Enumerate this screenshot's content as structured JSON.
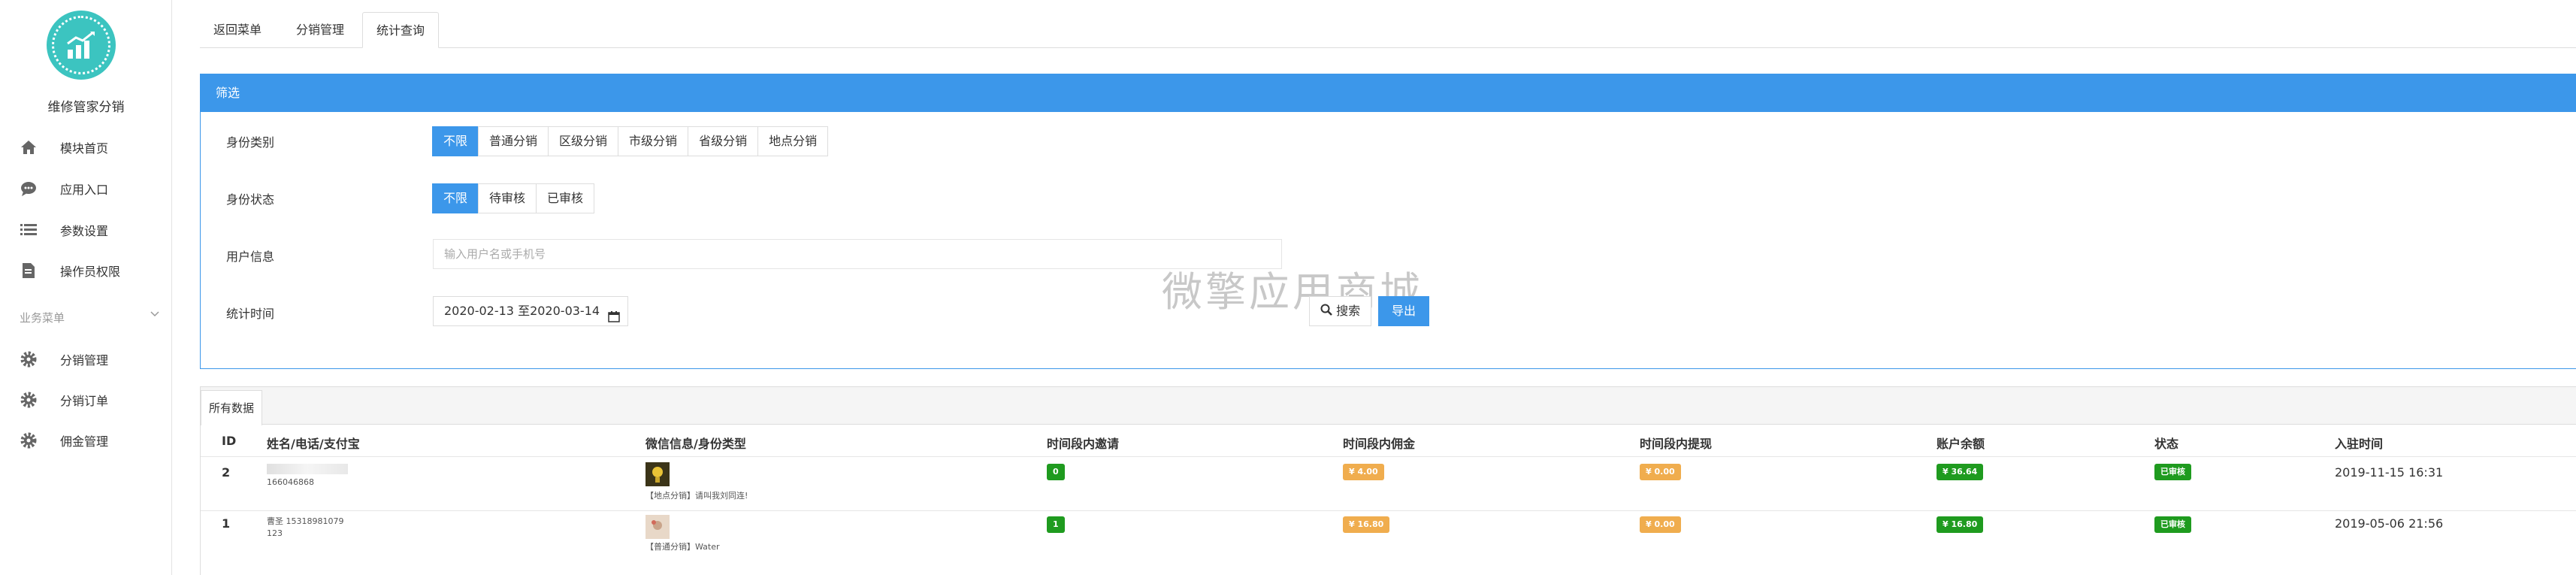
{
  "sidebar": {
    "app_name": "维修管家分销",
    "items": [
      {
        "label": "模块首页",
        "icon": "home-icon"
      },
      {
        "label": "应用入口",
        "icon": "chat-bubble-icon"
      },
      {
        "label": "参数设置",
        "icon": "list-settings-icon"
      },
      {
        "label": "操作员权限",
        "icon": "document-permission-icon"
      }
    ],
    "group_label": "业务菜单",
    "group_items": [
      {
        "label": "分销管理",
        "icon": "gear-icon"
      },
      {
        "label": "分销订单",
        "icon": "gear-icon"
      },
      {
        "label": "佣金管理",
        "icon": "gear-icon"
      }
    ]
  },
  "tabs": [
    "返回菜单",
    "分销管理",
    "统计查询"
  ],
  "filter": {
    "title": "筛选",
    "identity_type_label": "身份类别",
    "identity_types": [
      "不限",
      "普通分销",
      "区级分销",
      "市级分销",
      "省级分销",
      "地点分销"
    ],
    "status_label": "身份状态",
    "statuses": [
      "不限",
      "待审核",
      "已审核"
    ],
    "user_info_label": "用户信息",
    "user_info_placeholder": "输入用户名或手机号",
    "time_label": "统计时间",
    "date_range": "2020-02-13 至2020-03-14",
    "search_label": "搜索",
    "export_label": "导出"
  },
  "watermark": "微擎应用商城",
  "data": {
    "tab_label": "所有数据",
    "headers": [
      "ID",
      "姓名/电话/支付宝",
      "微信信息/身份类型",
      "时间段内邀请",
      "时间段内佣金",
      "时间段内提现",
      "账户余额",
      "状态",
      "入驻时间"
    ],
    "rows": [
      {
        "id": "2",
        "name_line1": "",
        "name_line2": "166046868",
        "wechat_info": "【地点分销】请叫我刘同连!",
        "invites": "0",
        "commission": "¥ 4.00",
        "withdrawn": "¥ 0.00",
        "balance": "¥ 36.64",
        "status": "已审核",
        "joined": "2019-11-15 16:31"
      },
      {
        "id": "1",
        "name_line1": "曹圣 15318981079",
        "name_line2": "123",
        "wechat_info": "【普通分销】Water",
        "invites": "1",
        "commission": "¥ 16.80",
        "withdrawn": "¥ 0.00",
        "balance": "¥ 16.80",
        "status": "已审核",
        "joined": "2019-05-06 21:56"
      }
    ]
  },
  "colors": {
    "primary": "#3c97ea",
    "logo": "#3cc4c0",
    "badge_green": "#1f9b1f",
    "badge_orange": "#f0ad4e"
  }
}
